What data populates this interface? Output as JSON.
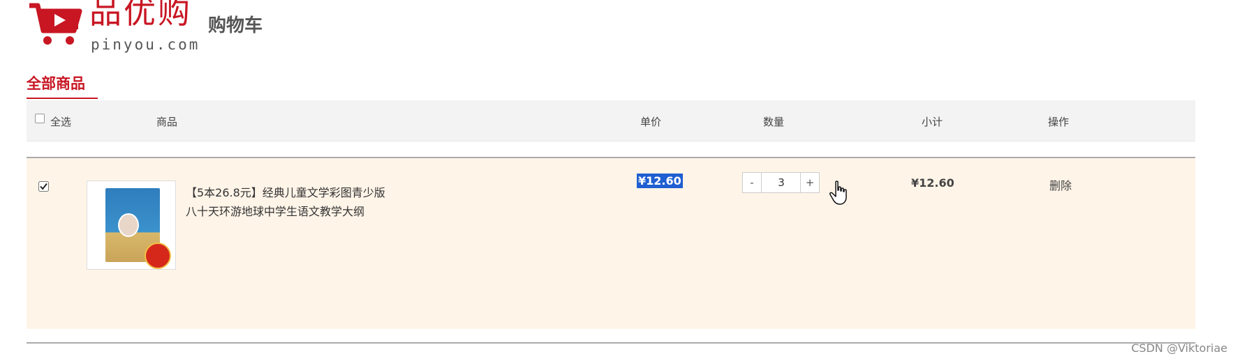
{
  "header": {
    "logo_title": "品优购",
    "logo_sub": "pinyou.com",
    "page_title": "购物车"
  },
  "tabs": {
    "all_label": "全部商品"
  },
  "table": {
    "select_all_label": "全选",
    "col_goods": "商品",
    "col_price": "单价",
    "col_qty": "数量",
    "col_subtotal": "小计",
    "col_action": "操作"
  },
  "item": {
    "checked": true,
    "name": "【5本26.8元】经典儿童文学彩图青少版八十天环游地球中学生语文教学大纲",
    "price": "¥12.60",
    "qty_minus": "-",
    "quantity": "3",
    "qty_plus": "+",
    "subtotal": "¥12.60",
    "delete_label": "删除"
  },
  "watermark": "CSDN @Viktoriae",
  "colors": {
    "brand": "#c81623",
    "row_bg": "#fff4e8",
    "selection": "#1f5fd1"
  }
}
